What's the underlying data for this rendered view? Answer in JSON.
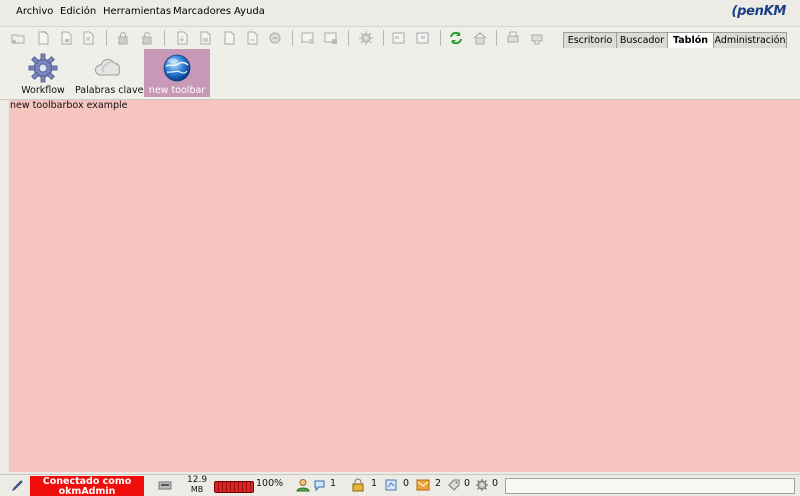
{
  "menubar": {
    "items": [
      "Archivo",
      "Edición",
      "Herramientas",
      "Marcadores",
      "Ayuda"
    ],
    "logo": "penKM"
  },
  "toolbar": {
    "buttons": [
      "new-folder",
      "new-document",
      "add-document",
      "scan-document",
      "lock",
      "unlock",
      "download",
      "export",
      "checkout",
      "checkin",
      "cancel-checkout",
      "delete",
      "add-property",
      "remove-property",
      "workflow",
      "copy",
      "move",
      "refresh",
      "home",
      "print",
      "add-bookmark"
    ]
  },
  "tabs": {
    "items": [
      "Escritorio",
      "Buscador",
      "Tablón",
      "Administración"
    ],
    "active": "Tablón"
  },
  "toolbox": {
    "items": [
      {
        "label": "Workflow",
        "icon": "gear-icon"
      },
      {
        "label": "Palabras clave",
        "icon": "cloud-icon"
      },
      {
        "label": "new toolbar",
        "icon": "globe-icon"
      }
    ],
    "active": "new toolbar"
  },
  "content": {
    "text": "new toolbarbox example",
    "background": "#f6c5bf"
  },
  "status": {
    "connected_line1": "Conectado como",
    "connected_line2": "okmAdmin",
    "memory_value": "12.9",
    "memory_unit": "MB",
    "progress_percent": "100%",
    "progress_fraction": 1.0,
    "users_count": "1",
    "locked_count": "1",
    "checkout_count": "0",
    "mail_count": "2",
    "bookmarks_count": "0",
    "tasks_count": "0"
  },
  "colors": {
    "accent": "#c799b7",
    "connected_bg": "#f20d0d",
    "progress": "#c81a1a"
  }
}
